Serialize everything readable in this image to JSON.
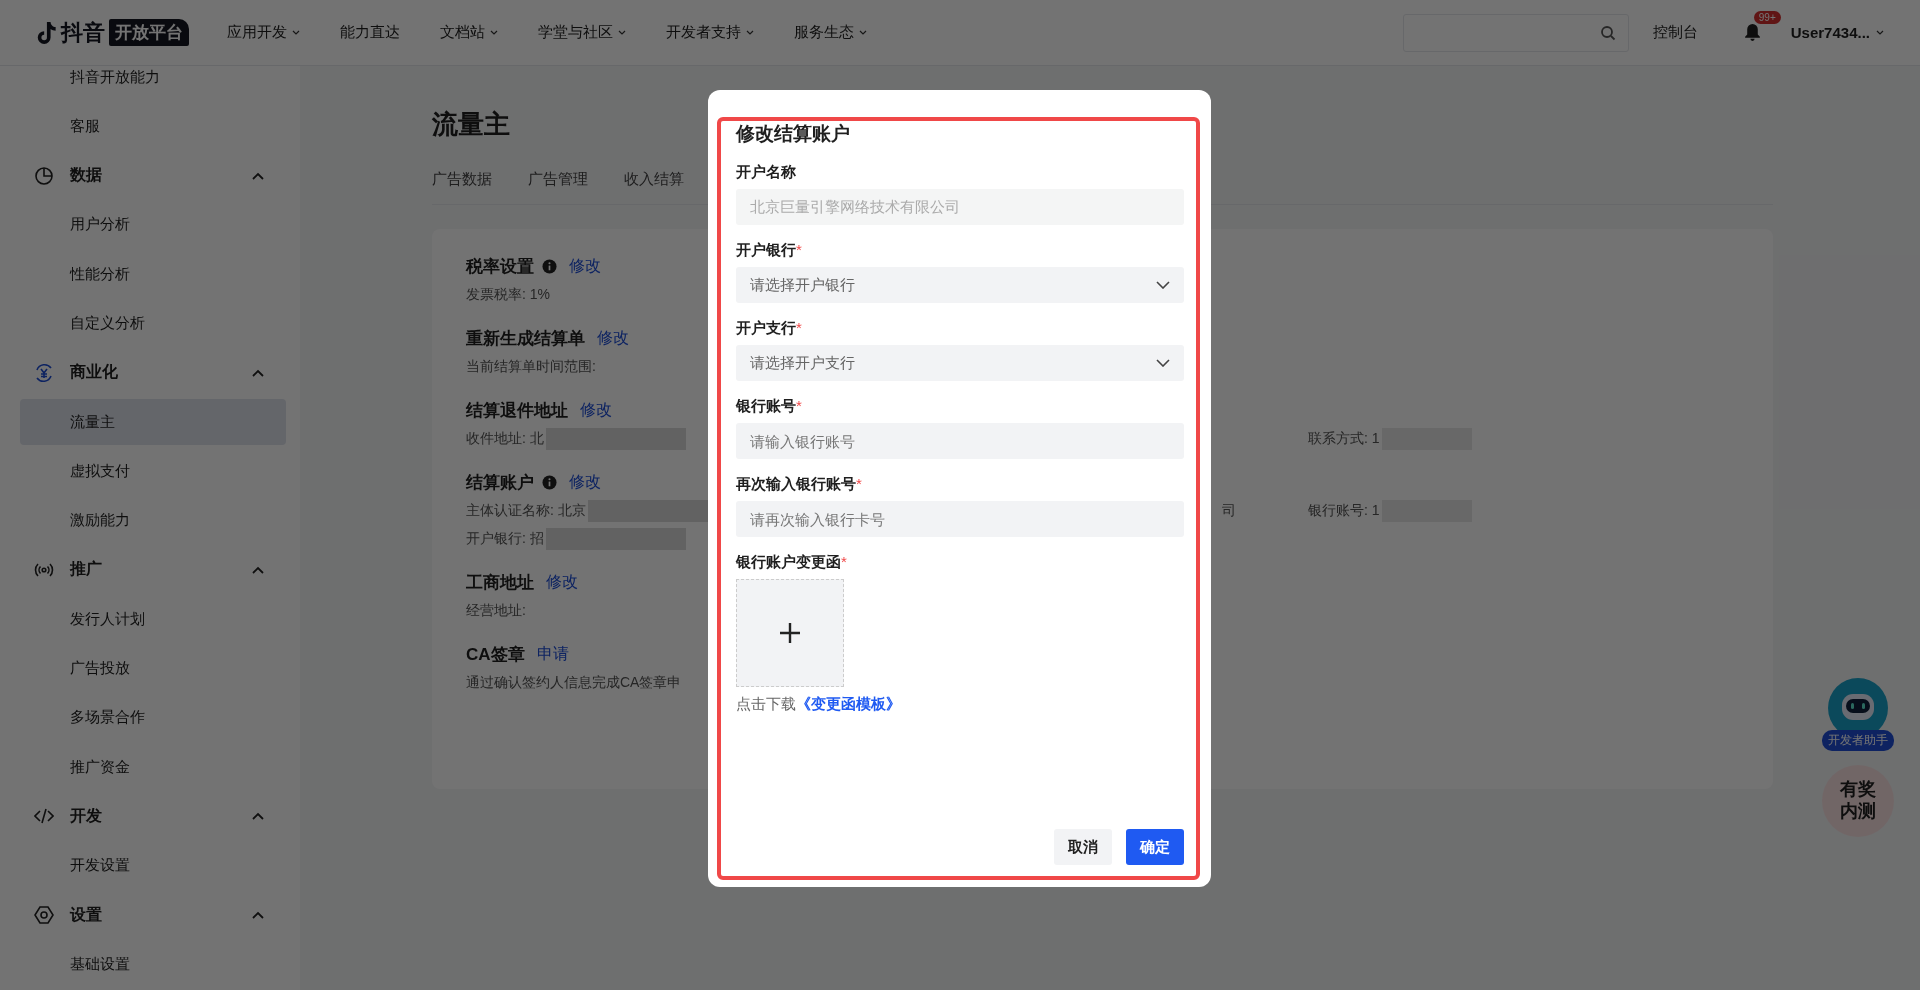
{
  "header": {
    "logo_text": "抖音",
    "logo_badge": "开放平台",
    "nav": [
      {
        "label": "应用开发",
        "dropdown": true
      },
      {
        "label": "能力直达",
        "dropdown": false
      },
      {
        "label": "文档站",
        "dropdown": true
      },
      {
        "label": "学堂与社区",
        "dropdown": true
      },
      {
        "label": "开发者支持",
        "dropdown": true
      },
      {
        "label": "服务生态",
        "dropdown": true
      }
    ],
    "console": "控制台",
    "notifications_badge": "99+",
    "user": "User7434..."
  },
  "sidebar": {
    "items": [
      {
        "label": "抖音开放能力",
        "kind": "link",
        "selected": false
      },
      {
        "label": "客服",
        "kind": "link",
        "selected": false
      },
      {
        "label": "数据",
        "kind": "group",
        "expanded": true,
        "active": false,
        "children": [
          {
            "label": "用户分析",
            "selected": false
          },
          {
            "label": "性能分析",
            "selected": false
          },
          {
            "label": "自定义分析",
            "selected": false
          }
        ]
      },
      {
        "label": "商业化",
        "kind": "group",
        "expanded": true,
        "active": true,
        "children": [
          {
            "label": "流量主",
            "selected": true
          },
          {
            "label": "虚拟支付",
            "selected": false
          },
          {
            "label": "激励能力",
            "selected": false
          }
        ]
      },
      {
        "label": "推广",
        "kind": "group",
        "expanded": true,
        "active": false,
        "children": [
          {
            "label": "发行人计划",
            "selected": false
          },
          {
            "label": "广告投放",
            "selected": false
          },
          {
            "label": "多场景合作",
            "selected": false
          },
          {
            "label": "推广资金",
            "selected": false
          }
        ]
      },
      {
        "label": "开发",
        "kind": "group",
        "expanded": true,
        "active": false,
        "children": [
          {
            "label": "开发设置",
            "selected": false
          }
        ]
      },
      {
        "label": "设置",
        "kind": "group",
        "expanded": true,
        "active": false,
        "children": [
          {
            "label": "基础设置",
            "selected": false
          }
        ]
      }
    ]
  },
  "page": {
    "title": "流量主",
    "tabs": [
      {
        "label": "广告数据",
        "selected": false
      },
      {
        "label": "广告管理",
        "selected": false
      },
      {
        "label": "收入结算",
        "selected": false
      }
    ],
    "sections": [
      {
        "title": "税率设置",
        "info": true,
        "action": "修改",
        "lines": [
          {
            "left": {
              "text": "发票税率: 1%",
              "redacted": false
            }
          }
        ]
      },
      {
        "title": "重新生成结算单",
        "info": false,
        "action": "修改",
        "lines": [
          {
            "left": {
              "text": "当前结算单时间范围:",
              "redacted": false
            }
          }
        ]
      },
      {
        "title": "结算退件地址",
        "info": false,
        "action": "修改",
        "lines": [
          {
            "left": {
              "text": "收件地址: 北",
              "redacted": true
            },
            "right": {
              "text": "联系方式: 1",
              "redacted": true
            }
          }
        ]
      },
      {
        "title": "结算账户",
        "info": true,
        "action": "修改",
        "lines": [
          {
            "left": {
              "text": "主体认证名称: 北京",
              "redacted": true
            },
            "middle": {
              "text": "司",
              "redacted": false
            },
            "right": {
              "text": "银行账号: 1",
              "redacted": true
            }
          },
          {
            "left": {
              "text": "开户银行: 招",
              "redacted": true
            }
          }
        ]
      },
      {
        "title": "工商地址",
        "info": false,
        "action": "修改",
        "lines": [
          {
            "left": {
              "text": "经营地址:",
              "redacted": false
            }
          }
        ]
      },
      {
        "title": "CA签章",
        "info": false,
        "action": "申请",
        "lines": [
          {
            "left": {
              "text": "通过确认签约人信息完成CA签章申",
              "redacted": false
            }
          }
        ]
      }
    ]
  },
  "modal": {
    "title": "修改结算账户",
    "fields": [
      {
        "kind": "text",
        "label": "开户名称",
        "value": "北京巨量引擎网络技术有限公司",
        "disabled": true
      },
      {
        "kind": "select",
        "label": "开户银行",
        "required_mark": "*",
        "placeholder": "请选择开户银行"
      },
      {
        "kind": "select",
        "label": "开户支行",
        "required_mark": "*",
        "placeholder": "请选择开户支行"
      },
      {
        "kind": "input",
        "label": "银行账号",
        "required_mark": "*",
        "placeholder": "请输入银行账号"
      },
      {
        "kind": "input",
        "label": "再次输入银行账号",
        "required_mark": "*",
        "placeholder": "请再次输入银行卡号"
      },
      {
        "kind": "upload",
        "label": "银行账户变更函",
        "required_mark": "*"
      }
    ],
    "hint": "点击下载",
    "hint_link": "《变更函模板》",
    "buttons": [
      {
        "label": "取消",
        "primary": false
      },
      {
        "label": "确定",
        "primary": true
      }
    ]
  },
  "widgets": {
    "assistant": "开发者助手",
    "beta": "有奖内测"
  }
}
